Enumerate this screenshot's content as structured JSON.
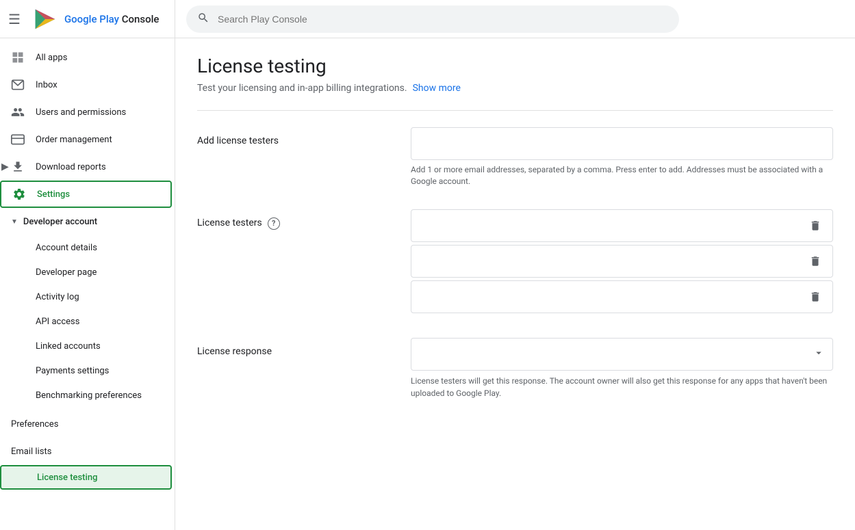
{
  "app": {
    "title": "Google Play Console",
    "title_google": "Google Play ",
    "title_console": "Console"
  },
  "search": {
    "placeholder": "Search Play Console"
  },
  "sidebar": {
    "nav_items": [
      {
        "id": "all-apps",
        "label": "All apps",
        "icon": "grid",
        "active": false
      },
      {
        "id": "inbox",
        "label": "Inbox",
        "icon": "inbox",
        "active": false
      },
      {
        "id": "users-permissions",
        "label": "Users and permissions",
        "icon": "person",
        "active": false
      },
      {
        "id": "order-management",
        "label": "Order management",
        "icon": "credit-card",
        "active": false
      },
      {
        "id": "download-reports",
        "label": "Download reports",
        "icon": "download",
        "active": false
      },
      {
        "id": "settings",
        "label": "Settings",
        "icon": "gear",
        "active": true
      }
    ],
    "developer_account": {
      "label": "Developer account",
      "sub_items": [
        {
          "id": "account-details",
          "label": "Account details"
        },
        {
          "id": "developer-page",
          "label": "Developer page"
        },
        {
          "id": "activity-log",
          "label": "Activity log"
        },
        {
          "id": "api-access",
          "label": "API access"
        },
        {
          "id": "linked-accounts",
          "label": "Linked accounts"
        },
        {
          "id": "payments-settings",
          "label": "Payments settings"
        },
        {
          "id": "benchmarking-preferences",
          "label": "Benchmarking preferences"
        }
      ]
    },
    "bottom_items": [
      {
        "id": "preferences",
        "label": "Preferences"
      },
      {
        "id": "email-lists",
        "label": "Email lists"
      },
      {
        "id": "license-testing",
        "label": "License testing",
        "selected": true
      }
    ]
  },
  "page": {
    "title": "License testing",
    "description": "Test your licensing and in-app billing integrations.",
    "show_more": "Show more"
  },
  "form": {
    "add_license_testers_label": "Add license testers",
    "add_license_testers_placeholder": "",
    "add_hint": "Add 1 or more email addresses, separated by a comma. Press enter to add. Addresses must be associated with a Google account.",
    "license_testers_label": "License testers",
    "tester_rows": [
      {
        "value": ""
      },
      {
        "value": ""
      },
      {
        "value": ""
      }
    ],
    "license_response_label": "License response",
    "license_response_placeholder": "",
    "response_hint": "License testers will get this response. The account owner will also get this response for any apps that haven't been uploaded to Google Play.",
    "response_options": [
      {
        "value": "",
        "label": ""
      }
    ]
  }
}
